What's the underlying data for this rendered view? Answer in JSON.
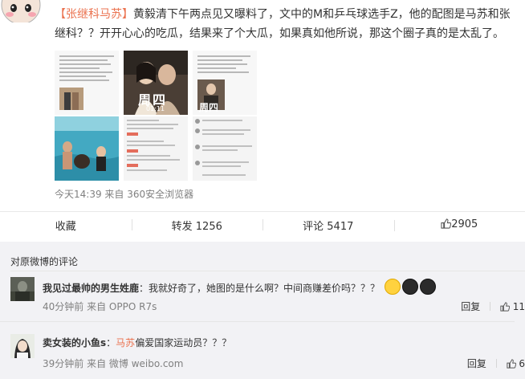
{
  "post": {
    "topic": "【张继科马苏】",
    "text": "黄毅清下午两点见又曝料了，文中的M和乒乓球选手Z，他的配图是马苏和张继科？？开开心心的吃瓜，结果来了个大瓜，如果真如他所说，那这个圈子真的是太乱了。",
    "time": "今天14:39",
    "source_prefix": "来自",
    "source": "360安全浏览器",
    "image_caption_1": "周四",
    "image_caption_1_time": "01:11",
    "image_caption_2": "周四"
  },
  "actions": {
    "favorite": "收藏",
    "repost": "转发 1256",
    "comment": "评论 5417",
    "like": "2905"
  },
  "comments_section": {
    "header": "对原微博的评论",
    "items": [
      {
        "user": "我见过最帅的男生姓鹿",
        "text": "：我就好奇了，她图的是什么啊？中间商赚差价吗？？？",
        "time": "40分钟前",
        "source": "来自 OPPO R7s",
        "reply": "回复",
        "likes": "11"
      },
      {
        "user": "卖女装的小鱼s",
        "mention": "马苏",
        "text_before": "：",
        "text": "偏爱国家运动员？？？",
        "time": "39分钟前",
        "source": "来自 微博 weibo.com",
        "reply": "回复",
        "likes": "6"
      }
    ]
  }
}
